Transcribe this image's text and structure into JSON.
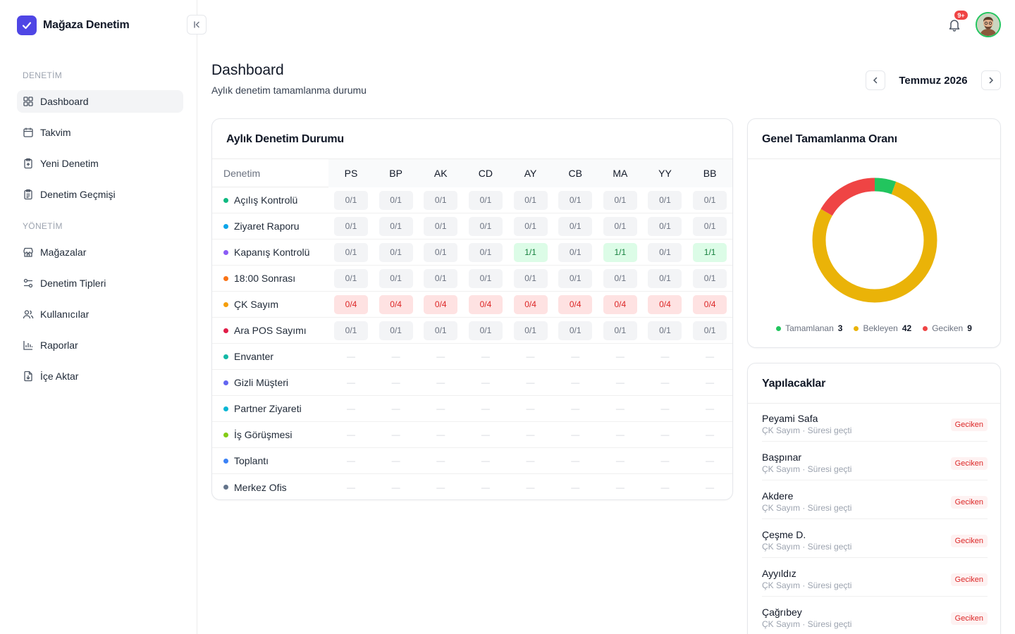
{
  "brand": {
    "name": "Mağaza Denetim"
  },
  "sidebar": {
    "sections": [
      "DENETİM",
      "YÖNETİM"
    ],
    "items": [
      {
        "label": "Dashboard",
        "icon": "grid-icon",
        "active": true
      },
      {
        "label": "Takvim",
        "icon": "calendar-icon"
      },
      {
        "label": "Yeni Denetim",
        "icon": "clipboard-plus-icon"
      },
      {
        "label": "Denetim Geçmişi",
        "icon": "clipboard-list-icon"
      },
      {
        "label": "Mağazalar",
        "icon": "store-icon"
      },
      {
        "label": "Denetim Tipleri",
        "icon": "sliders-icon"
      },
      {
        "label": "Kullanıcılar",
        "icon": "users-icon"
      },
      {
        "label": "Raporlar",
        "icon": "bar-chart-icon"
      },
      {
        "label": "İçe Aktar",
        "icon": "file-import-icon"
      }
    ]
  },
  "topbar": {
    "notification_badge": "9+"
  },
  "header": {
    "title": "Dashboard",
    "subtitle": "Aylık denetim tamamlanma durumu",
    "month": "Temmuz 2026"
  },
  "status": {
    "title": "Aylık Denetim Durumu",
    "first_column": "Denetim",
    "columns": [
      "PS",
      "BP",
      "AK",
      "CD",
      "AY",
      "CB",
      "MA",
      "YY",
      "BB"
    ],
    "rows": [
      {
        "name": "Açılış Kontrolü",
        "color": "#10b981",
        "cells": [
          "0/1",
          "0/1",
          "0/1",
          "0/1",
          "0/1",
          "0/1",
          "0/1",
          "0/1",
          "0/1"
        ]
      },
      {
        "name": "Ziyaret Raporu",
        "color": "#0ea5e9",
        "cells": [
          "0/1",
          "0/1",
          "0/1",
          "0/1",
          "0/1",
          "0/1",
          "0/1",
          "0/1",
          "0/1"
        ]
      },
      {
        "name": "Kapanış Kontrolü",
        "color": "#8b5cf6",
        "cells": [
          "0/1",
          "0/1",
          "0/1",
          "0/1",
          "1/1",
          "0/1",
          "1/1",
          "0/1",
          "1/1"
        ]
      },
      {
        "name": "18:00 Sonrası",
        "color": "#f97316",
        "cells": [
          "0/1",
          "0/1",
          "0/1",
          "0/1",
          "0/1",
          "0/1",
          "0/1",
          "0/1",
          "0/1"
        ]
      },
      {
        "name": "ÇK Sayım",
        "color": "#f59e0b",
        "cells": [
          "0/4",
          "0/4",
          "0/4",
          "0/4",
          "0/4",
          "0/4",
          "0/4",
          "0/4",
          "0/4"
        ],
        "late": true
      },
      {
        "name": "Ara POS Sayımı",
        "color": "#e11d48",
        "cells": [
          "0/1",
          "0/1",
          "0/1",
          "0/1",
          "0/1",
          "0/1",
          "0/1",
          "0/1",
          "0/1"
        ]
      },
      {
        "name": "Envanter",
        "color": "#14b8a6",
        "cells": [
          "—",
          "—",
          "—",
          "—",
          "—",
          "—",
          "—",
          "—",
          "—"
        ]
      },
      {
        "name": "Gizli Müşteri",
        "color": "#6366f1",
        "cells": [
          "—",
          "—",
          "—",
          "—",
          "—",
          "—",
          "—",
          "—",
          "—"
        ]
      },
      {
        "name": "Partner Ziyareti",
        "color": "#06b6d4",
        "cells": [
          "—",
          "—",
          "—",
          "—",
          "—",
          "—",
          "—",
          "—",
          "—"
        ]
      },
      {
        "name": "İş Görüşmesi",
        "color": "#84cc16",
        "cells": [
          "—",
          "—",
          "—",
          "—",
          "—",
          "—",
          "—",
          "—",
          "—"
        ]
      },
      {
        "name": "Toplantı",
        "color": "#3b82f6",
        "cells": [
          "—",
          "—",
          "—",
          "—",
          "—",
          "—",
          "—",
          "—",
          "—"
        ]
      },
      {
        "name": "Merkez Ofis",
        "color": "#64748b",
        "cells": [
          "—",
          "—",
          "—",
          "—",
          "—",
          "—",
          "—",
          "—",
          "—"
        ]
      }
    ]
  },
  "rate": {
    "title": "Genel Tamamlanma Oranı",
    "segments": [
      {
        "label": "Tamamlanan",
        "value": 3,
        "color": "#22c55e"
      },
      {
        "label": "Bekleyen",
        "value": 42,
        "color": "#eab308"
      },
      {
        "label": "Geciken",
        "value": 9,
        "color": "#ef4444"
      }
    ]
  },
  "todo": {
    "title": "Yapılacaklar",
    "items": [
      {
        "name": "Peyami Safa",
        "sub": "ÇK Sayım · Süresi geçti",
        "tag": "Geciken"
      },
      {
        "name": "Başpınar",
        "sub": "ÇK Sayım · Süresi geçti",
        "tag": "Geciken"
      },
      {
        "name": "Akdere",
        "sub": "ÇK Sayım · Süresi geçti",
        "tag": "Geciken"
      },
      {
        "name": "Çeşme D.",
        "sub": "ÇK Sayım · Süresi geçti",
        "tag": "Geciken"
      },
      {
        "name": "Ayyıldız",
        "sub": "ÇK Sayım · Süresi geçti",
        "tag": "Geciken"
      },
      {
        "name": "Çağrıbey",
        "sub": "ÇK Sayım · Süresi geçti",
        "tag": "Geciken"
      }
    ]
  }
}
